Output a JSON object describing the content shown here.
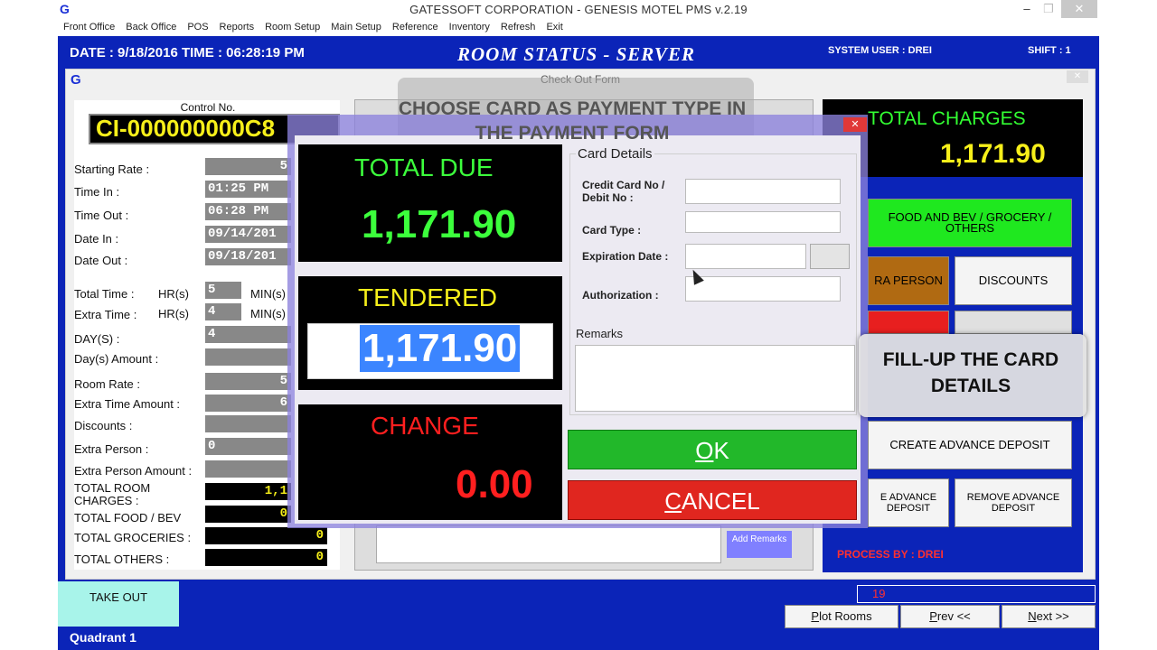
{
  "window": {
    "title": "GATESSOFT CORPORATION - GENESIS MOTEL PMS  v.2.19",
    "logo_letter": "G",
    "minimize": "–",
    "restore": "❐",
    "close": "✕"
  },
  "menu": [
    "Front Office",
    "Back Office",
    "POS",
    "Reports",
    "Room Setup",
    "Main Setup",
    "Reference",
    "Inventory",
    "Refresh",
    "Exit"
  ],
  "header": {
    "date_time": "DATE : 9/18/2016  TIME : 06:28:19 PM",
    "screen_title": "ROOM STATUS - SERVER",
    "system_user": "SYSTEM USER : DREI",
    "shift": "SHIFT : 1"
  },
  "checkout_form": {
    "title": "Check Out Form",
    "logo_letter": "G",
    "close": "✕",
    "control_label": "Control No.",
    "control_no": "CI-000000000C8",
    "fields": {
      "starting_rate": {
        "label": "Starting Rate :",
        "value": "5"
      },
      "time_in": {
        "label": "Time In :",
        "value": "01:25 PM"
      },
      "time_out": {
        "label": "Time Out :",
        "value": "06:28 PM"
      },
      "date_in": {
        "label": "Date In :",
        "value": "09/14/201"
      },
      "date_out": {
        "label": "Date Out :",
        "value": "09/18/201"
      },
      "total_time": {
        "label": "Total Time :",
        "hr_label": "HR(s)",
        "hr_value": "5",
        "min_label": "MIN(s)"
      },
      "extra_time": {
        "label": "Extra Time :",
        "hr_label": "HR(s)",
        "hr_value": "4",
        "min_label": "MIN(s)"
      },
      "days": {
        "label": "DAY(S) :",
        "value": "4"
      },
      "days_amount": {
        "label": "Day(s) Amount :",
        "value": ""
      },
      "room_rate": {
        "label": "Room Rate :",
        "value": "5"
      },
      "extra_time_amount": {
        "label": "Extra Time Amount :",
        "value": "6"
      },
      "discounts": {
        "label": "Discounts :",
        "value": ""
      },
      "extra_person": {
        "label": "Extra Person :",
        "value": "0"
      },
      "extra_person_amount": {
        "label": "Extra Person Amount :",
        "value": ""
      },
      "total_room_charges": {
        "label": "TOTAL ROOM CHARGES :",
        "value": "1,1"
      },
      "total_food_bev": {
        "label": "TOTAL FOOD / BEV",
        "value": "0"
      },
      "total_groceries": {
        "label": "TOTAL GROCERIES :",
        "value": "0"
      },
      "total_others": {
        "label": "TOTAL OTHERS :",
        "value": "0"
      }
    },
    "add_remarks": "Add Remarks"
  },
  "right_panel": {
    "total_charges_label": "TOTAL CHARGES",
    "total_charges_value": "1,171.90",
    "food_bev_btn": "FOOD AND BEV / GROCERY / OTHERS",
    "extra_person_btn": "RA PERSON",
    "discounts_btn": "DISCOUNTS",
    "create_advance_btn": "CREATE ADVANCE DEPOSIT",
    "use_advance_btn": "E ADVANCE DEPOSIT",
    "remove_advance_btn": "REMOVE ADVANCE DEPOSIT",
    "process_by": "PROCESS BY : DREI",
    "count": "19",
    "colors": {
      "green_btn": "#1fe81f",
      "brown_btn": "#b06a12",
      "red_btn": "#e81f1f"
    }
  },
  "payment_dialog": {
    "close": "✕",
    "total_due_label": "TOTAL DUE",
    "total_due_value": "1,171.90",
    "tendered_label": "TENDERED",
    "tendered_value": "1,171.90",
    "change_label": "CHANGE",
    "change_value": "0.00",
    "card_details_title": "Card Details",
    "credit_card_label_1": "Credit Card No /",
    "credit_card_label_2": "Debit No :",
    "card_type_label": "Card Type :",
    "expiration_label": "Expiration Date :",
    "authorization_label": "Authorization :",
    "remarks_label": "Remarks",
    "ok_letter": "O",
    "ok_rest": "K",
    "cancel_letter": "C",
    "cancel_rest": "ANCEL"
  },
  "callouts": {
    "top": "CHOOSE CARD AS PAYMENT TYPE IN THE PAYMENT FORM",
    "right": "FILL-UP THE CARD DETAILS"
  },
  "bottom": {
    "takeout": "TAKE OUT",
    "quadrant": "Quadrant 1",
    "plot_rooms_p": "P",
    "plot_rooms_rest": "lot Rooms",
    "prev_p": "P",
    "prev_rest": "rev <<",
    "next_n": "N",
    "next_rest": "ext >>"
  }
}
